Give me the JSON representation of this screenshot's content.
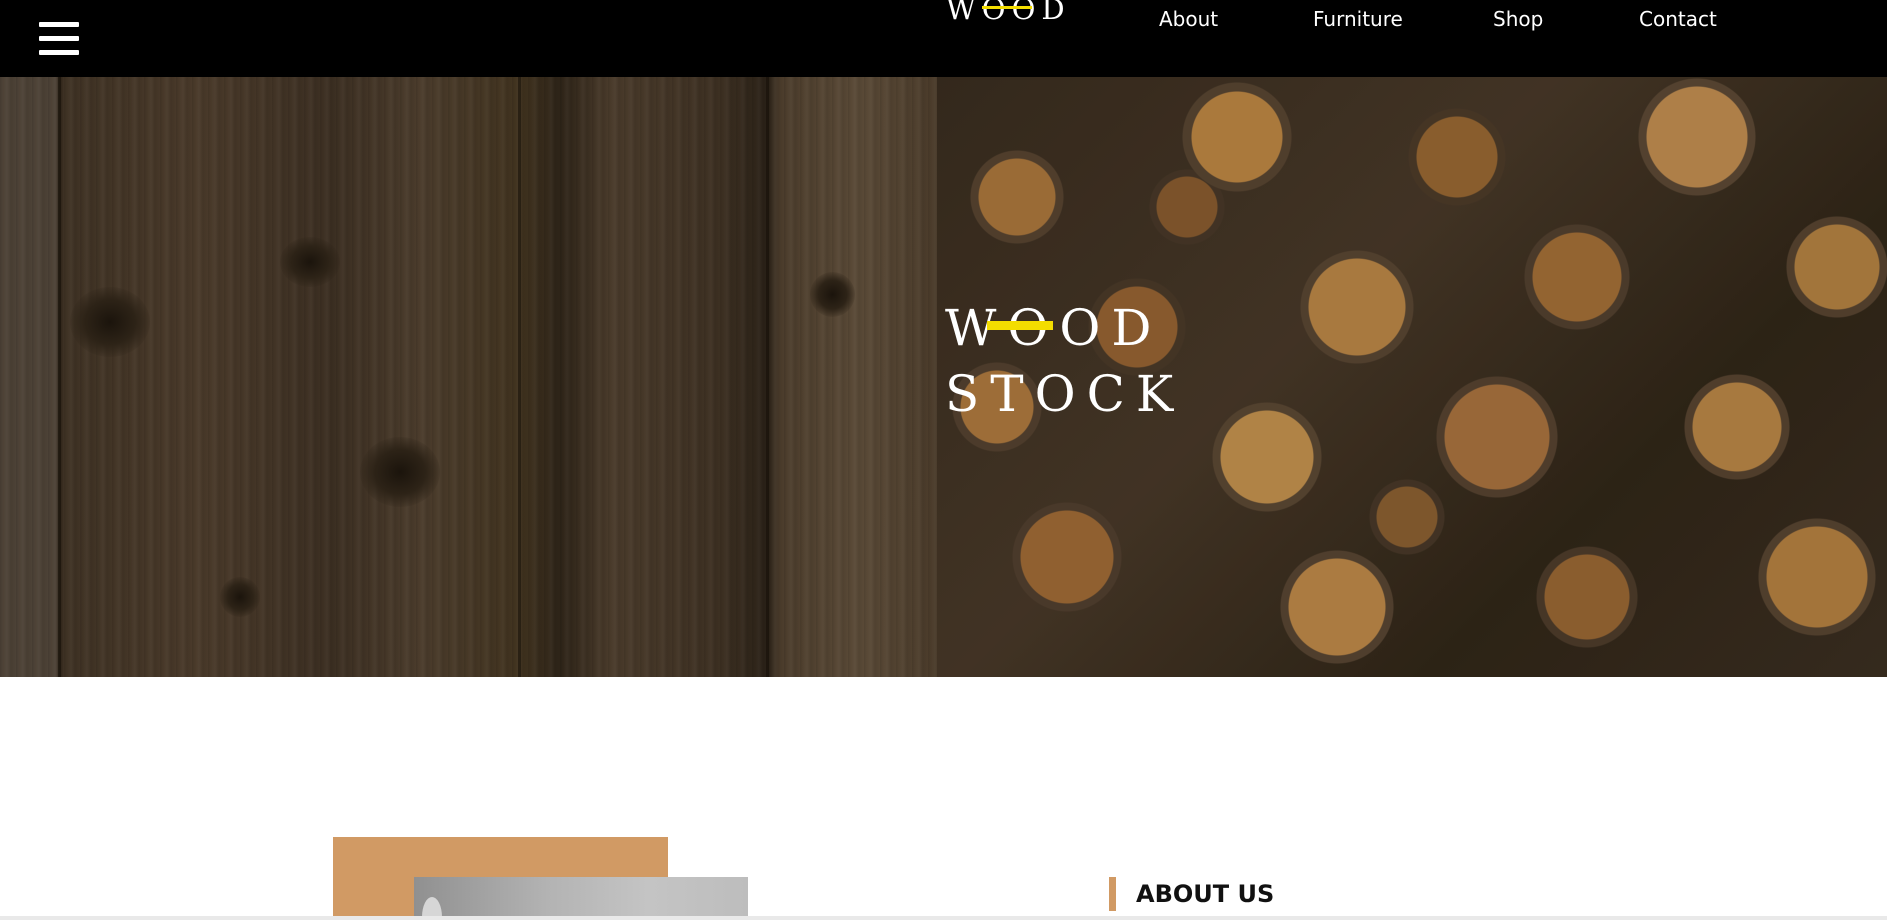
{
  "header": {
    "logo_text": "WOOD",
    "nav": [
      "About",
      "Furniture",
      "Shop",
      "Contact"
    ]
  },
  "hero": {
    "title_line1": "WOOD",
    "title_line2": "STOCK"
  },
  "about": {
    "heading": "ABOUT US"
  },
  "colors": {
    "header_bg": "#000000",
    "accent_yellow": "#f3dd00",
    "accent_tan": "#d19a64",
    "text_light": "#ffffff",
    "text_dark": "#111111"
  },
  "icons": {
    "menu": "hamburger-menu-icon"
  }
}
